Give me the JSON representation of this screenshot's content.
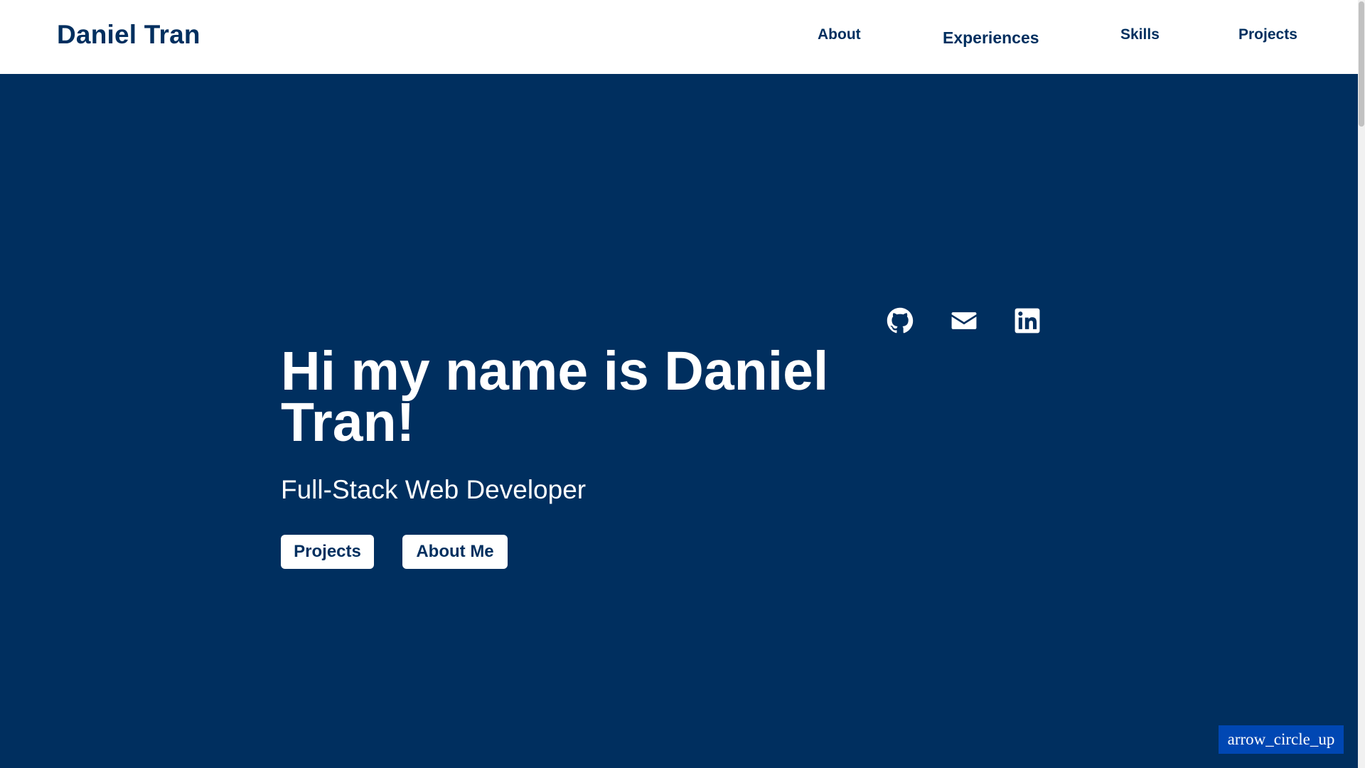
{
  "header": {
    "brand": "Daniel Tran",
    "nav": {
      "about": "About",
      "experiences": "Experiences",
      "skills": "Skills",
      "projects": "Projects"
    }
  },
  "hero": {
    "title": "Hi my name is Daniel Tran!",
    "subtitle": "Full-Stack Web Developer",
    "buttons": {
      "projects": "Projects",
      "about": "About Me"
    }
  },
  "social": {
    "icons": [
      "github-icon",
      "mail-icon",
      "linkedin-icon"
    ]
  },
  "back_to_top": {
    "label": "arrow_circle_up"
  },
  "colors": {
    "background": "#002f5f",
    "header": "#ffffff",
    "accent_button": "#0047b3",
    "text_light": "#ffffff"
  }
}
